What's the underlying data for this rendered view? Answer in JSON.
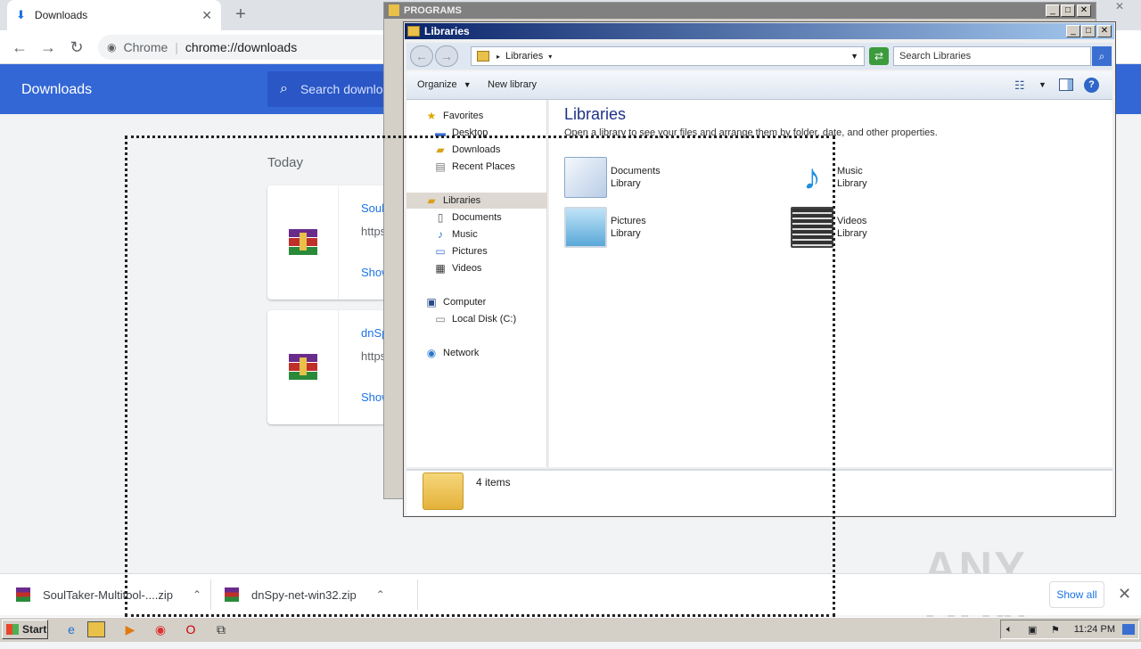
{
  "chrome": {
    "tab_title": "Downloads",
    "tab_close": "✕",
    "new_tab": "+",
    "omnibox_site": "Chrome",
    "omnibox_url": "chrome://downloads",
    "page_title": "Downloads",
    "search_placeholder": "Search downlo",
    "section": "Today",
    "downloads": [
      {
        "name": "Soul",
        "url": "https",
        "action": "Show"
      },
      {
        "name": "dnSp",
        "url": "https",
        "action": "Show"
      }
    ],
    "shelf": [
      {
        "file": "SoulTaker-Multitool-....zip"
      },
      {
        "file": "dnSpy-net-win32.zip"
      }
    ],
    "show_all": "Show all",
    "watermark": "ANY RUN"
  },
  "programs_window": {
    "title": "PROGRAMS"
  },
  "libraries_window": {
    "title": "Libraries",
    "address": "Libraries",
    "search_placeholder": "Search Libraries",
    "commands": {
      "organize": "Organize",
      "new_library": "New library"
    },
    "nav": {
      "favorites": "Favorites",
      "desktop": "Desktop",
      "downloads": "Downloads",
      "recent": "Recent Places",
      "libraries": "Libraries",
      "documents": "Documents",
      "music": "Music",
      "pictures": "Pictures",
      "videos": "Videos",
      "computer": "Computer",
      "local_disk": "Local Disk (C:)",
      "network": "Network"
    },
    "heading": "Libraries",
    "subheading": "Open a library to see your files and arrange them by folder, date, and other properties.",
    "libraries": [
      {
        "name": "Documents",
        "type": "Library"
      },
      {
        "name": "Music",
        "type": "Library"
      },
      {
        "name": "Pictures",
        "type": "Library"
      },
      {
        "name": "Videos",
        "type": "Library"
      }
    ],
    "item_count": "4 items"
  },
  "taskbar": {
    "start": "Start",
    "clock": "11:24 PM"
  },
  "colors": {
    "chrome_blue": "#3367d6",
    "link_blue": "#1a73e8",
    "xp_title": "#0a246a"
  }
}
